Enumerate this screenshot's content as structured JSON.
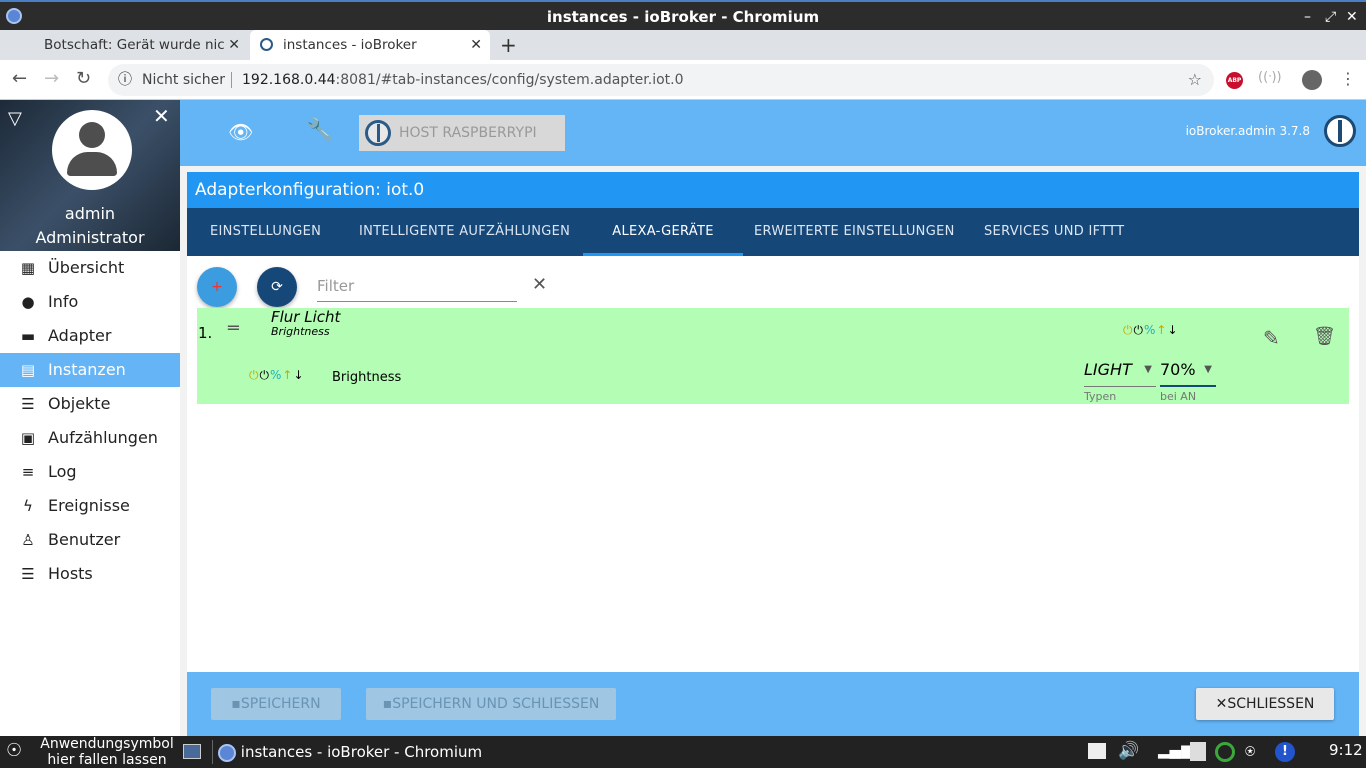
{
  "window": {
    "title": "instances - ioBroker - Chromium",
    "controls": [
      "–",
      "⤢",
      "✕"
    ]
  },
  "browser": {
    "tabs": [
      {
        "label": "Botschaft: Gerät wurde nic"
      },
      {
        "label": "instances - ioBroker"
      }
    ],
    "security": "Nicht sicher",
    "url_host": "192.168.0.44",
    "url_rest": ":8081/#tab-instances/config/system.adapter.iot.0"
  },
  "sidebar": {
    "user_name": "admin",
    "user_role": "Administrator",
    "items": [
      {
        "label": "Übersicht",
        "icon": "grid-icon"
      },
      {
        "label": "Info",
        "icon": "info-icon"
      },
      {
        "label": "Adapter",
        "icon": "store-icon"
      },
      {
        "label": "Instanzen",
        "icon": "instances-icon"
      },
      {
        "label": "Objekte",
        "icon": "list-icon"
      },
      {
        "label": "Aufzählungen",
        "icon": "enum-icon"
      },
      {
        "label": "Log",
        "icon": "log-icon"
      },
      {
        "label": "Ereignisse",
        "icon": "bolt-icon"
      },
      {
        "label": "Benutzer",
        "icon": "user-icon"
      },
      {
        "label": "Hosts",
        "icon": "hosts-icon"
      }
    ],
    "active_item": "Instanzen"
  },
  "topbar": {
    "host_label": "HOST RASPBERRYPI",
    "version": "ioBroker.admin 3.7.8"
  },
  "config": {
    "title": "Adapterkonfiguration: iot.0",
    "tabs": [
      "EINSTELLUNGEN",
      "INTELLIGENTE AUFZÄHLUNGEN",
      "ALEXA-GERÄTE",
      "ERWEITERTE EINSTELLUNGEN",
      "SERVICES UND IFTTT"
    ],
    "active_tab": "ALEXA-GERÄTE",
    "add_label": "+",
    "refresh_label": "⟳",
    "filter_placeholder": "Filter",
    "devices": [
      {
        "index": "1.",
        "name": "Flur Licht",
        "subtitle": "Brightness",
        "state_label": "Brightness",
        "type_value": "LIGHT",
        "type_caption": "Typen",
        "on_value": "70%",
        "on_caption": "bei AN"
      }
    ],
    "buttons": {
      "save": "SPEICHERN",
      "save_close": "SPEICHERN UND SCHLIESSEN",
      "close": "SCHLIESSEN"
    }
  },
  "taskbar": {
    "drop_hint_line1": "Anwendungsymbol",
    "drop_hint_line2": "hier fallen lassen",
    "task_label": "instances - ioBroker - Chromium",
    "clock": "9:12"
  },
  "colors": {
    "accent": "#64b5f6",
    "header_blue": "#2196f3",
    "tabs_dark": "#164779",
    "row_green": "#b4fdb4",
    "active_nav": "#64b4f6"
  }
}
